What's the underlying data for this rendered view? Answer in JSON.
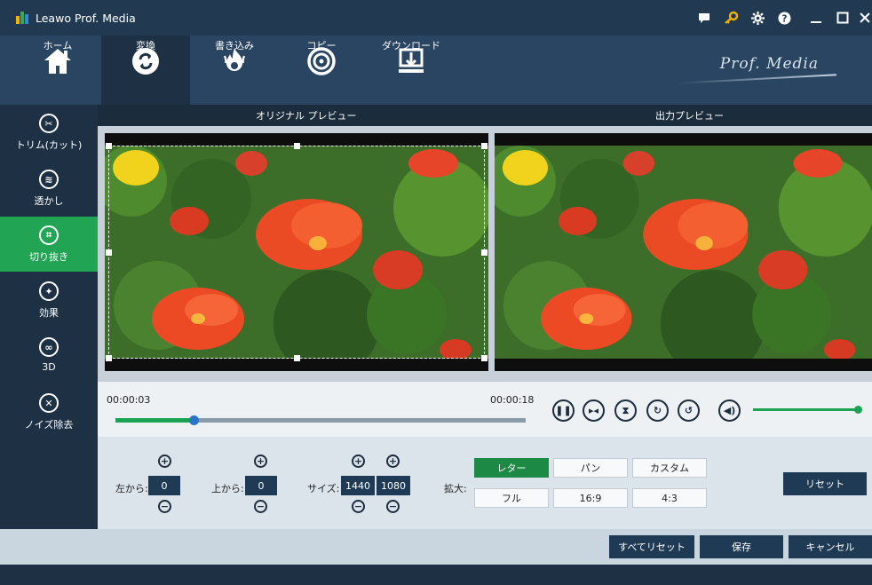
{
  "app": {
    "title": "Leawo Prof. Media",
    "brand": "Prof. Media"
  },
  "title_icons": [
    "chat-icon",
    "key-icon",
    "gear-icon",
    "help-icon",
    "minimize-icon",
    "maximize-icon",
    "close-icon"
  ],
  "toolbar": {
    "tabs": [
      {
        "label": "ホーム",
        "icon": "home-icon",
        "active": false
      },
      {
        "label": "変換",
        "icon": "convert-icon",
        "active": true
      },
      {
        "label": "書き込み",
        "icon": "burn-icon",
        "active": false
      },
      {
        "label": "コピー",
        "icon": "copy-disc-icon",
        "active": false
      },
      {
        "label": "ダウンロード",
        "icon": "download-icon",
        "active": false
      }
    ]
  },
  "sidebar": {
    "items": [
      {
        "label": "トリム(カット)",
        "icon": "scissors-icon",
        "active": false
      },
      {
        "label": "透かし",
        "icon": "watermark-icon",
        "active": false
      },
      {
        "label": "切り抜き",
        "icon": "crop-icon",
        "active": true
      },
      {
        "label": "効果",
        "icon": "effect-icon",
        "active": false
      },
      {
        "label": "3D",
        "icon": "3d-glasses-icon",
        "active": false
      },
      {
        "label": "ノイズ除去",
        "icon": "denoise-icon",
        "active": false
      }
    ]
  },
  "preview": {
    "original_label": "オリジナル プレビュー",
    "output_label": "出力プレビュー"
  },
  "player": {
    "current_time": "00:00:03",
    "total_time": "00:00:18",
    "progress": 0.19,
    "volume": 1.0
  },
  "crop": {
    "left_label": "左から:",
    "left_value": "0",
    "top_label": "上から:",
    "top_value": "0",
    "size_label": "サイズ:",
    "width_value": "1440",
    "height_value": "1080",
    "zoom_label": "拡大:",
    "zoom_options": [
      "レター",
      "パン",
      "カスタム",
      "フル",
      "16:9",
      "4:3"
    ],
    "zoom_selected": "レター",
    "reset_label": "リセット"
  },
  "footer": {
    "reset_all_label": "すべてリセット",
    "save_label": "保存",
    "cancel_label": "キャンセル"
  },
  "colors": {
    "accent_green": "#21a454",
    "dark_navy": "#1e3a55",
    "toolbar_bg": "#2a4561"
  }
}
